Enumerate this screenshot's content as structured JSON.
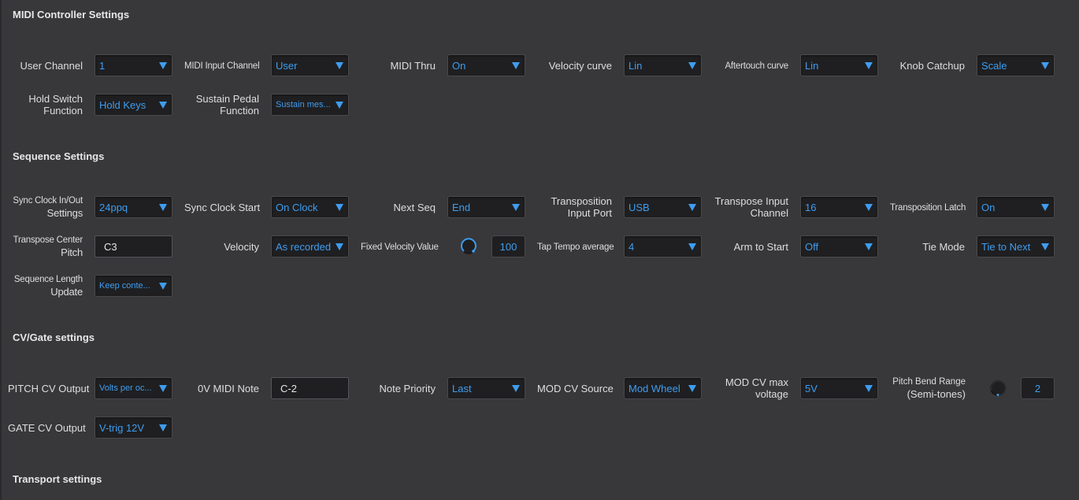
{
  "sections": {
    "midi": "MIDI Controller Settings",
    "sequence": "Sequence Settings",
    "cvgate": "CV/Gate settings",
    "transport": "Transport settings"
  },
  "midi": {
    "user_channel": {
      "label": "User Channel",
      "value": "1"
    },
    "midi_input_channel": {
      "label": "MIDI Input Channel",
      "value": "User"
    },
    "midi_thru": {
      "label": "MIDI Thru",
      "value": "On"
    },
    "velocity_curve": {
      "label": "Velocity curve",
      "value": "Lin"
    },
    "aftertouch_curve": {
      "label": "Aftertouch curve",
      "value": "Lin"
    },
    "knob_catchup": {
      "label": "Knob Catchup",
      "value": "Scale"
    },
    "hold_switch": {
      "label1": "Hold Switch",
      "label2": "Function",
      "value": "Hold Keys"
    },
    "sustain_pedal": {
      "label1": "Sustain Pedal",
      "label2": "Function",
      "value": "Sustain mes..."
    }
  },
  "sequence": {
    "sync_clock_inout": {
      "label1": "Sync Clock In/Out",
      "label2": "Settings",
      "value": "24ppq"
    },
    "sync_clock_start": {
      "label": "Sync Clock Start",
      "value": "On Clock"
    },
    "next_seq": {
      "label": "Next Seq",
      "value": "End"
    },
    "transposition_input_port": {
      "label1": "Transposition",
      "label2": "Input Port",
      "value": "USB"
    },
    "transpose_input_channel": {
      "label1": "Transpose Input",
      "label2": "Channel",
      "value": "16"
    },
    "transposition_latch": {
      "label": "Transposition Latch",
      "value": "On"
    },
    "transpose_center_pitch": {
      "label1": "Transpose Center",
      "label2": "Pitch",
      "value": "C3"
    },
    "velocity": {
      "label": "Velocity",
      "value": "As recorded"
    },
    "fixed_velocity": {
      "label": "Fixed Velocity Value",
      "value": "100"
    },
    "tap_tempo": {
      "label": "Tap Tempo average",
      "value": "4"
    },
    "arm_to_start": {
      "label": "Arm to Start",
      "value": "Off"
    },
    "tie_mode": {
      "label": "Tie Mode",
      "value": "Tie to Next"
    },
    "seq_length_update": {
      "label1": "Sequence Length",
      "label2": "Update",
      "value": "Keep conte..."
    }
  },
  "cvgate": {
    "pitch_cv_output": {
      "label": "PITCH CV Output",
      "value": "Volts per oc..."
    },
    "zero_v_midi_note": {
      "label": "0V MIDI Note",
      "value": "C-2"
    },
    "note_priority": {
      "label": "Note Priority",
      "value": "Last"
    },
    "mod_cv_source": {
      "label": "MOD CV Source",
      "value": "Mod Wheel"
    },
    "mod_cv_max": {
      "label1": "MOD CV max",
      "label2": "voltage",
      "value": "5V"
    },
    "pitch_bend_range": {
      "label1": "Pitch Bend Range",
      "label2": "(Semi-tones)",
      "value": "2"
    },
    "gate_cv_output": {
      "label": "GATE CV Output",
      "value": "V-trig 12V"
    }
  },
  "colors": {
    "accent": "#3e9df0",
    "background": "#38383b",
    "field": "#1f1f21"
  }
}
